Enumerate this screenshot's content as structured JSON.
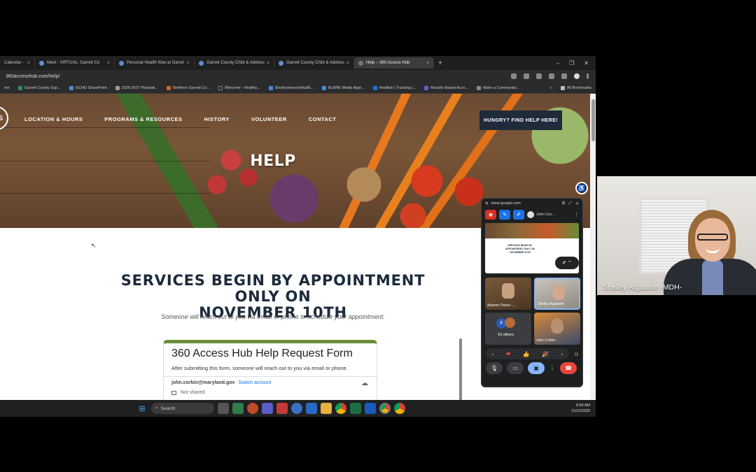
{
  "browser": {
    "tabs": [
      {
        "label": "Calendar -",
        "active": false
      },
      {
        "label": "Meet - VIRTUAL: Garrett Co",
        "active": false
      },
      {
        "label": "Personal Health Now at Garret",
        "active": false
      },
      {
        "label": "Garrett County Child & Adolesc",
        "active": false
      },
      {
        "label": "Garrett County Child & Adolesc",
        "active": false
      },
      {
        "label": "Help – 360 Access Hub",
        "active": true
      }
    ],
    "new_tab": "+",
    "window_controls": [
      "–",
      "❐",
      "✕"
    ],
    "url": "360accesshub.com/help/",
    "bookmarks": [
      "me",
      "Garrett County Sup...",
      "GCHD SharePoint",
      "2025-2027 Populati...",
      "Northern Garrett Co...",
      "Welcome - Healthy...",
      "ShelleyHarvestHubB...",
      "BLANK Media Appr...",
      "Heatfisk | Tracking |...",
      "Results-Based Acco...",
      "Make a Community..."
    ],
    "bookmarks_overflow": "»",
    "all_bookmarks": "All Bookmarks"
  },
  "site": {
    "logo_glyph": "S",
    "nav": [
      "LOCATION & HOURS",
      "PROGRAMS & RESOURCES",
      "HISTORY",
      "VOLUNTEER",
      "CONTACT"
    ],
    "cta": "HUNGRY? FIND HELP HERE!",
    "hero_title": "HELP",
    "headline_line1": "SERVICES BEGIN BY APPOINTMENT ONLY ON",
    "headline_line2": "NOVEMBER 10TH",
    "subline": "Someone will reach out to you via email or phone to schedule your appointment.",
    "form": {
      "title": "360 Access Hub Help Request Form",
      "description": "After submitting this form, someone will reach out to you via email or phone.",
      "account": "john.corbin@maryland.gov",
      "switch_account": "Switch account",
      "not_shared": "Not shared"
    }
  },
  "meet_pip": {
    "domain": "meet.google.com",
    "user": "John Cor...",
    "share_preview_text": "SERVICES BEGIN BY APPOINTMENT ONLY ON NOVEMBER 10TH",
    "tiles": [
      {
        "name": "Autumn Friend -..."
      },
      {
        "name": "Shelley Argabrite"
      },
      {
        "initial": "F",
        "count": "16 others"
      },
      {
        "name": "John Corbin..."
      }
    ],
    "reactions": [
      "‹",
      "❤",
      "👍",
      "🎉",
      "›"
    ],
    "emoji_button": "☺"
  },
  "taskbar": {
    "search_placeholder": "Search",
    "time": "8:58 AM",
    "date": "11/12/2025"
  },
  "participant": {
    "name": "Shelley Argabrite -MDH-"
  },
  "colors": {
    "nav_dark": "#1f2a3a",
    "form_accent": "#6b8e3a",
    "end_call": "#e8453c",
    "present_active": "#8ab4f8"
  }
}
